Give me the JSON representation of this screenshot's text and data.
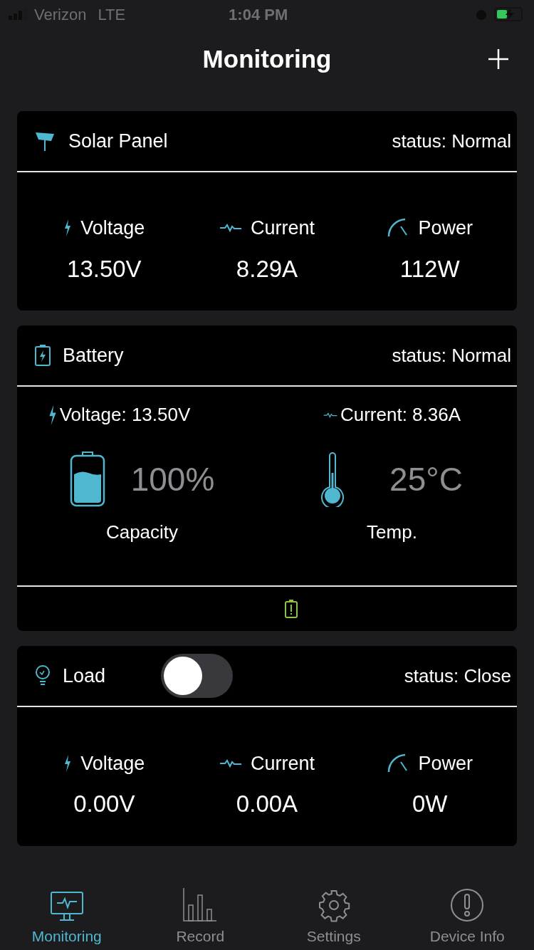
{
  "status_bar": {
    "carrier": "Verizon",
    "network": "LTE",
    "time": "1:04 PM"
  },
  "header": {
    "title": "Monitoring"
  },
  "solar": {
    "title": "Solar Panel",
    "status": "status: Normal",
    "metrics": [
      {
        "kind": "voltage",
        "label": "Voltage",
        "value": "13.50V"
      },
      {
        "kind": "current",
        "label": "Current",
        "value": "8.29A"
      },
      {
        "kind": "power",
        "label": "Power",
        "value": "112W"
      }
    ]
  },
  "battery": {
    "title": "Battery",
    "status": "status: Normal",
    "voltage": "Voltage: 13.50V",
    "current": "Current: 8.36A",
    "capacity": {
      "value": "100%",
      "label": "Capacity"
    },
    "temp": {
      "value": "25°C",
      "label": "Temp."
    }
  },
  "load": {
    "title": "Load",
    "on": false,
    "status": "status: Close",
    "metrics": [
      {
        "kind": "voltage",
        "label": "Voltage",
        "value": "0.00V"
      },
      {
        "kind": "current",
        "label": "Current",
        "value": "0.00A"
      },
      {
        "kind": "power",
        "label": "Power",
        "value": "0W"
      }
    ]
  },
  "tabs": [
    {
      "kind": "monitor",
      "label": "Monitoring",
      "selected": true
    },
    {
      "kind": "record",
      "label": "Record",
      "selected": false
    },
    {
      "kind": "settings",
      "label": "Settings",
      "selected": false
    },
    {
      "kind": "info",
      "label": "Device Info",
      "selected": false
    }
  ]
}
